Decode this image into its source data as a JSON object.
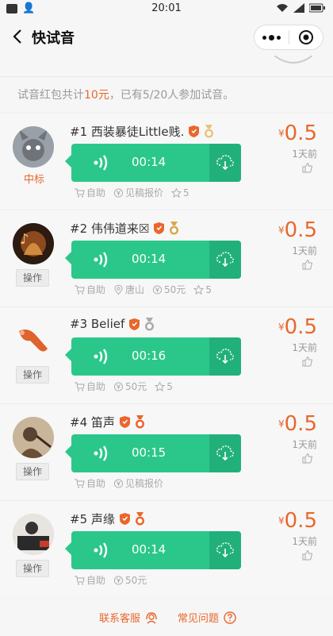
{
  "status_bar": {
    "time": "20:01",
    "left_icons": [
      "square-icon",
      "person-icon"
    ],
    "right_icons": [
      "wifi-icon",
      "signal-icon",
      "battery-icon"
    ]
  },
  "nav": {
    "title": "快试音",
    "back_icon": "chevron-left-icon",
    "menu_icon": "more-dots-icon",
    "close_icon": "target-icon"
  },
  "summary": {
    "prefix": "试音红包共计",
    "amount": "10元",
    "suffix": "，已有5/20人参加试音。"
  },
  "items": [
    {
      "rank_name": "#1 西装暴徒Little贱.",
      "duration": "00:14",
      "status_label": "中标",
      "meta": [
        {
          "icon": "cart-icon",
          "text": "自助"
        },
        {
          "icon": "yen-icon",
          "text": "见稿报价"
        },
        {
          "icon": "star-icon",
          "text": "5"
        }
      ],
      "price_yen": "¥",
      "price": "0.5",
      "time_ago": "1天前",
      "medal_color": "#e8c27a"
    },
    {
      "rank_name": "#2 伟伟道来☒",
      "duration": "00:14",
      "button_label": "操作",
      "meta": [
        {
          "icon": "cart-icon",
          "text": "自助"
        },
        {
          "icon": "location-icon",
          "text": "唐山"
        },
        {
          "icon": "yen-icon",
          "text": "50元"
        },
        {
          "icon": "star-icon",
          "text": "5"
        }
      ],
      "price_yen": "¥",
      "price": "0.5",
      "time_ago": "1天前",
      "medal_color": "#d6a94f"
    },
    {
      "rank_name": "#3 Belief",
      "duration": "00:16",
      "button_label": "操作",
      "meta": [
        {
          "icon": "cart-icon",
          "text": "自助"
        },
        {
          "icon": "yen-icon",
          "text": "50元"
        },
        {
          "icon": "star-icon",
          "text": "5"
        }
      ],
      "price_yen": "¥",
      "price": "0.5",
      "time_ago": "1天前",
      "medal_color": "#aaaaaa"
    },
    {
      "rank_name": "#4 笛声",
      "duration": "00:15",
      "button_label": "操作",
      "meta": [
        {
          "icon": "cart-icon",
          "text": "自助"
        },
        {
          "icon": "yen-icon",
          "text": "见稿报价"
        }
      ],
      "price_yen": "¥",
      "price": "0.5",
      "time_ago": "1天前",
      "medal_color": "#e9672c"
    },
    {
      "rank_name": "#5 声缘",
      "duration": "00:14",
      "button_label": "操作",
      "meta": [
        {
          "icon": "cart-icon",
          "text": "自助"
        },
        {
          "icon": "yen-icon",
          "text": "50元"
        }
      ],
      "price_yen": "¥",
      "price": "0.5",
      "time_ago": "1天前",
      "medal_color": "#e9672c"
    }
  ],
  "footer": {
    "contact": "联系客服",
    "faq": "常见问题"
  },
  "colors": {
    "accent": "#e9672c",
    "player": "#2bc78a",
    "player_dark": "#22b07a"
  }
}
